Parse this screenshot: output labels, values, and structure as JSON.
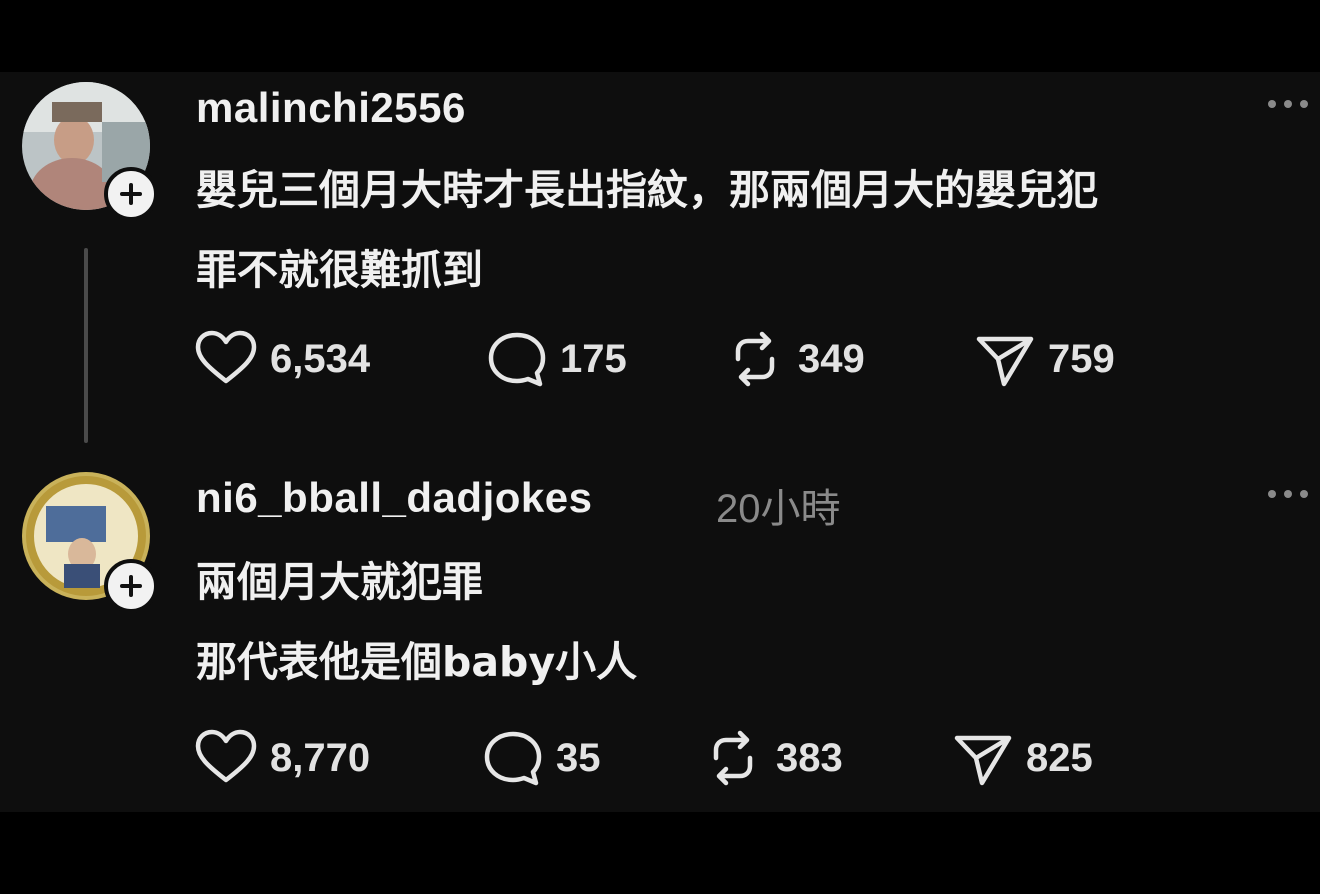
{
  "posts": [
    {
      "username": "malinchi2556",
      "timestamp": "",
      "lines": [
        "嬰兒三個月大時才長出指紋，那兩個月大的嬰兒犯",
        "罪不就很難抓到"
      ],
      "likes": "6,534",
      "replies": "175",
      "reposts": "349",
      "shares": "759"
    },
    {
      "username": "ni6_bball_dadjokes",
      "timestamp": "20小時",
      "lines": [
        "兩個月大就犯罪",
        "那代表他是個baby小人"
      ],
      "likes": "8,770",
      "replies": "35",
      "reposts": "383",
      "shares": "825"
    }
  ],
  "colors": {
    "background": "#000000",
    "panel": "#0e0e0e",
    "text": "#f0f0f0",
    "muted": "#8a8a8a"
  },
  "icons": [
    "heart-icon",
    "comment-icon",
    "repost-icon",
    "send-icon",
    "more-icon",
    "plus-icon"
  ]
}
